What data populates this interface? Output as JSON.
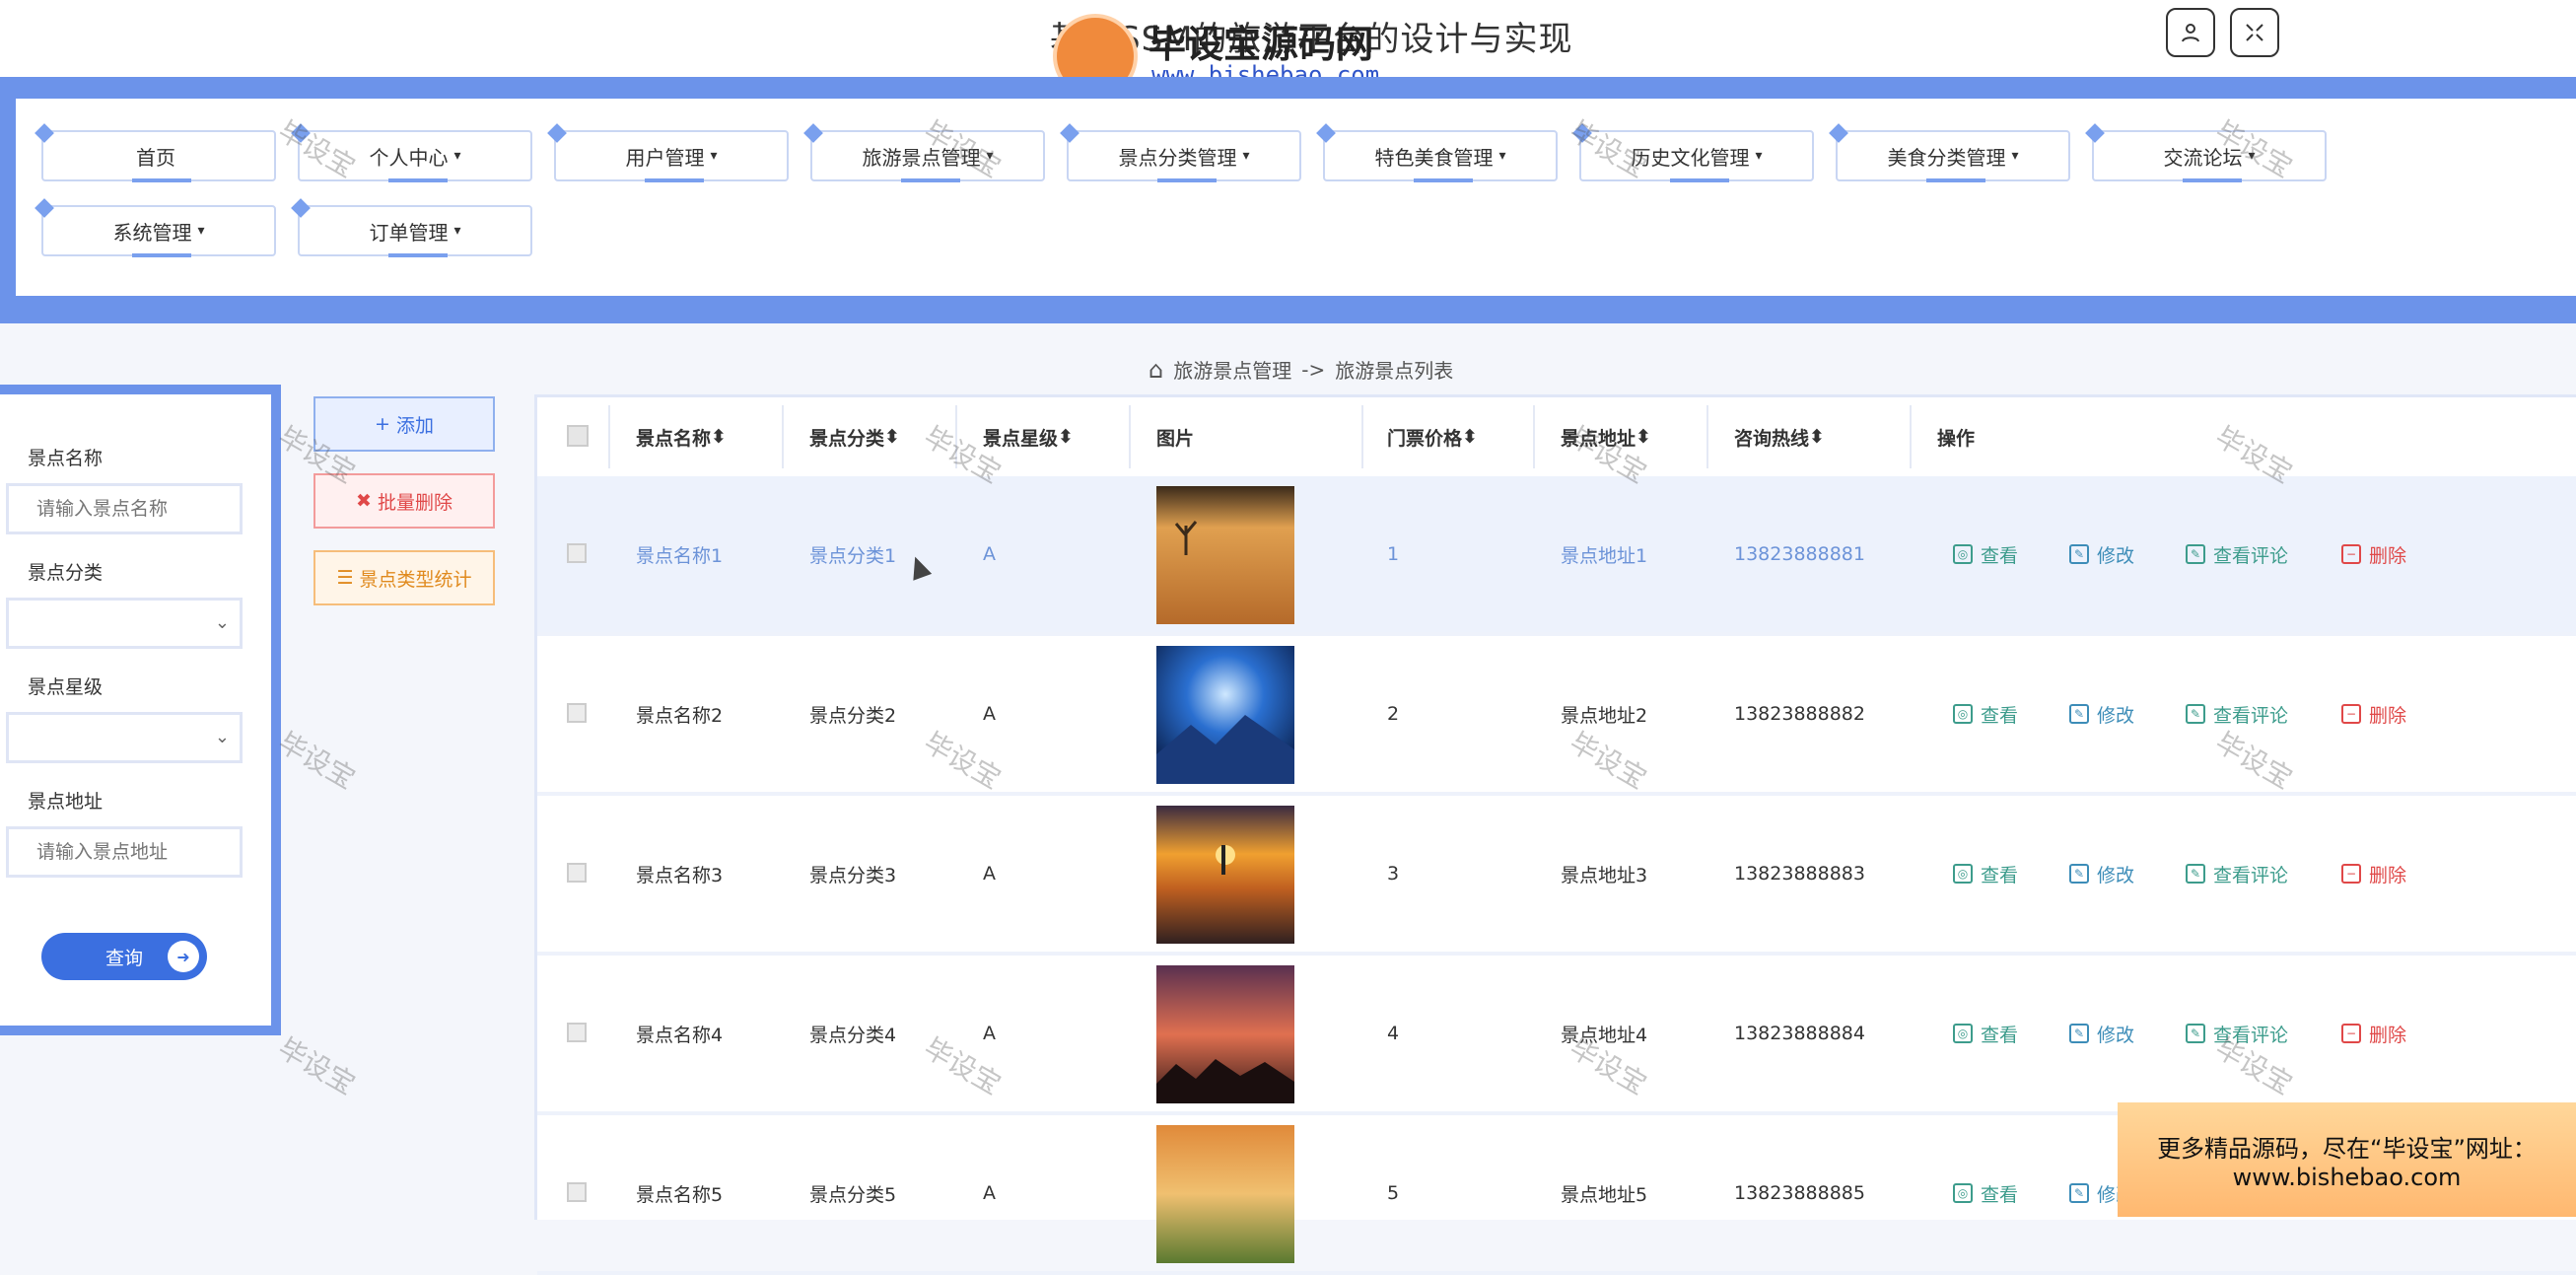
{
  "header": {
    "title": "基于SSM的旅游平台的设计与实现",
    "logo_name": "毕设宝源码网",
    "logo_url": "www.bishebao.com"
  },
  "nav": {
    "items": [
      {
        "label": "首页",
        "caret": ""
      },
      {
        "label": "个人中心",
        "caret": "▾"
      },
      {
        "label": "用户管理",
        "caret": "▾"
      },
      {
        "label": "旅游景点管理",
        "caret": "▾"
      },
      {
        "label": "景点分类管理",
        "caret": "▾"
      },
      {
        "label": "特色美食管理",
        "caret": "▾"
      },
      {
        "label": "历史文化管理",
        "caret": "▾"
      },
      {
        "label": "美食分类管理",
        "caret": "▾"
      },
      {
        "label": "交流论坛",
        "caret": "▾"
      },
      {
        "label": "系统管理",
        "caret": "▾"
      },
      {
        "label": "订单管理",
        "caret": "▾"
      }
    ]
  },
  "breadcrumb": {
    "parent": "旅游景点管理",
    "sep": "->",
    "current": "旅游景点列表"
  },
  "search": {
    "name_label": "景点名称",
    "name_placeholder": "请输入景点名称",
    "category_label": "景点分类",
    "level_label": "景点星级",
    "address_label": "景点地址",
    "address_placeholder": "请输入景点地址",
    "query_label": "查询"
  },
  "actions": {
    "add": "添加",
    "batch_delete": "批量删除",
    "stats": "景点类型统计"
  },
  "table": {
    "headers": [
      "景点名称",
      "景点分类",
      "景点星级",
      "图片",
      "门票价格",
      "景点地址",
      "咨询热线",
      "操作"
    ],
    "sort_icon": "⬍",
    "rows": [
      {
        "name": "景点名称1",
        "category": "景点分类1",
        "level": "A",
        "price": "1",
        "address": "景点地址1",
        "phone": "13823888881",
        "image": "desert-tree-image"
      },
      {
        "name": "景点名称2",
        "category": "景点分类2",
        "level": "A",
        "price": "2",
        "address": "景点地址2",
        "phone": "13823888882",
        "image": "blue-mountains-image"
      },
      {
        "name": "景点名称3",
        "category": "景点分类3",
        "level": "A",
        "price": "3",
        "address": "景点地址3",
        "phone": "13823888883",
        "image": "sunset-pier-image"
      },
      {
        "name": "景点名称4",
        "category": "景点分类4",
        "level": "A",
        "price": "4",
        "address": "景点地址4",
        "phone": "13823888884",
        "image": "sunset-trees-image"
      },
      {
        "name": "景点名称5",
        "category": "景点分类5",
        "level": "A",
        "price": "5",
        "address": "景点地址5",
        "phone": "13823888885",
        "image": "meadow-sunset-image"
      }
    ],
    "ops": {
      "view": "查看",
      "edit": "修改",
      "comments": "查看评论",
      "delete": "删除"
    }
  },
  "promo": {
    "line1": "更多精品源码，尽在“毕设宝”网址：",
    "line2": "www.bishebao.com"
  },
  "watermark": "毕设宝",
  "colors": {
    "accent": "#3b6fe0",
    "nav_frame": "#6c93ea",
    "danger": "#e04848",
    "warning": "#e08a1e",
    "teal": "#3d9c8c"
  }
}
